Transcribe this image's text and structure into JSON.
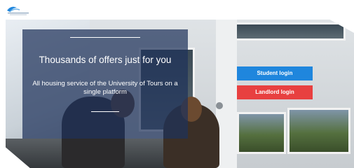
{
  "brand": {
    "logo_text": "",
    "accent_color": "#1f86dd"
  },
  "hero": {
    "headline": "Thousands of offers just for you",
    "subline": "All housing service of the University of Tours on a single platform"
  },
  "actions": {
    "student_login": "Student login",
    "landlord_login": "Landlord login",
    "student_color": "#1f86dd",
    "landlord_color": "#e84040"
  }
}
